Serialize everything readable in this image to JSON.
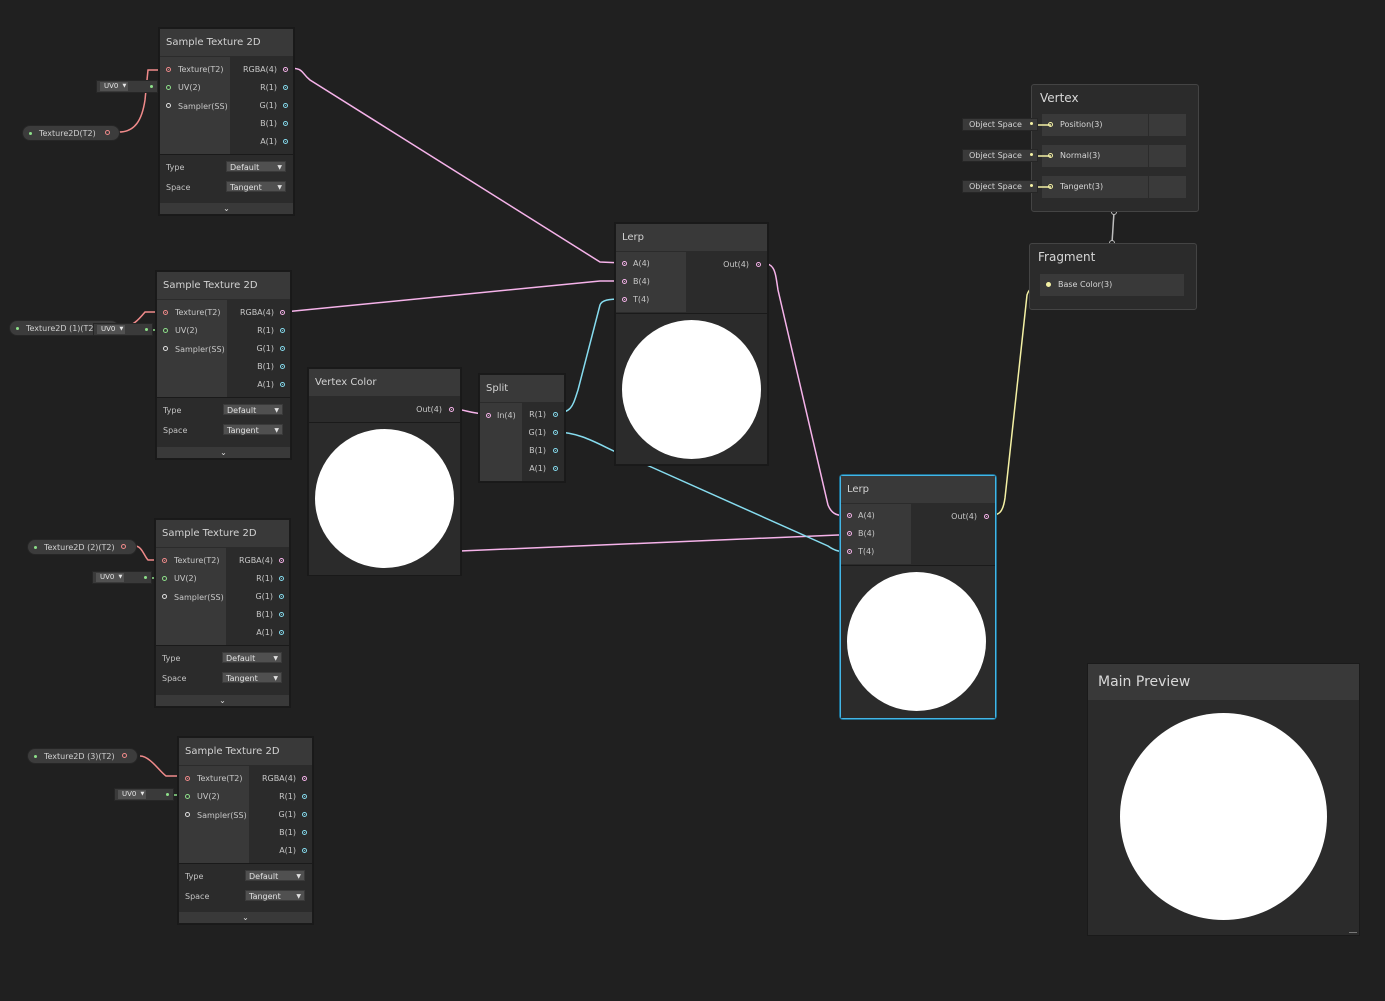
{
  "colors": {
    "background": "#202020",
    "texture_wire": "#f08a8a",
    "uv_wire": "#8ee08a",
    "vector4_wire": "#f6b3ea",
    "vector1_wire": "#86dcef",
    "vector3_wire": "#f4f1a4",
    "selection": "#44b6e6"
  },
  "sample_texture": {
    "title": "Sample Texture 2D",
    "inputs": [
      "Texture(T2)",
      "UV(2)",
      "Sampler(SS)"
    ],
    "outputs": [
      "RGBA(4)",
      "R(1)",
      "G(1)",
      "B(1)",
      "A(1)"
    ],
    "type_label": "Type",
    "type_value": "Default",
    "space_label": "Space",
    "space_value": "Tangent",
    "collapse_icon": "chevron-down-icon"
  },
  "properties": {
    "tex1": "Texture2D(T2)",
    "tex2": "Texture2D (1)(T2",
    "tex3": "Texture2D (2)(T2)",
    "tex4": "Texture2D (3)(T2)",
    "uv": "UV0"
  },
  "vertex_color": {
    "title": "Vertex Color",
    "out": "Out(4)"
  },
  "split": {
    "title": "Split",
    "in": "In(4)",
    "outputs": [
      "R(1)",
      "G(1)",
      "B(1)",
      "A(1)"
    ]
  },
  "lerp": {
    "title": "Lerp",
    "inputs": [
      "A(4)",
      "B(4)",
      "T(4)"
    ],
    "out": "Out(4)"
  },
  "vertex": {
    "title": "Vertex",
    "fields": [
      {
        "space": "Object Space",
        "label": "Position(3)"
      },
      {
        "space": "Object Space",
        "label": "Normal(3)"
      },
      {
        "space": "Object Space",
        "label": "Tangent(3)"
      }
    ]
  },
  "fragment": {
    "title": "Fragment",
    "field": "Base Color(3)"
  },
  "main_preview": {
    "title": "Main Preview"
  }
}
